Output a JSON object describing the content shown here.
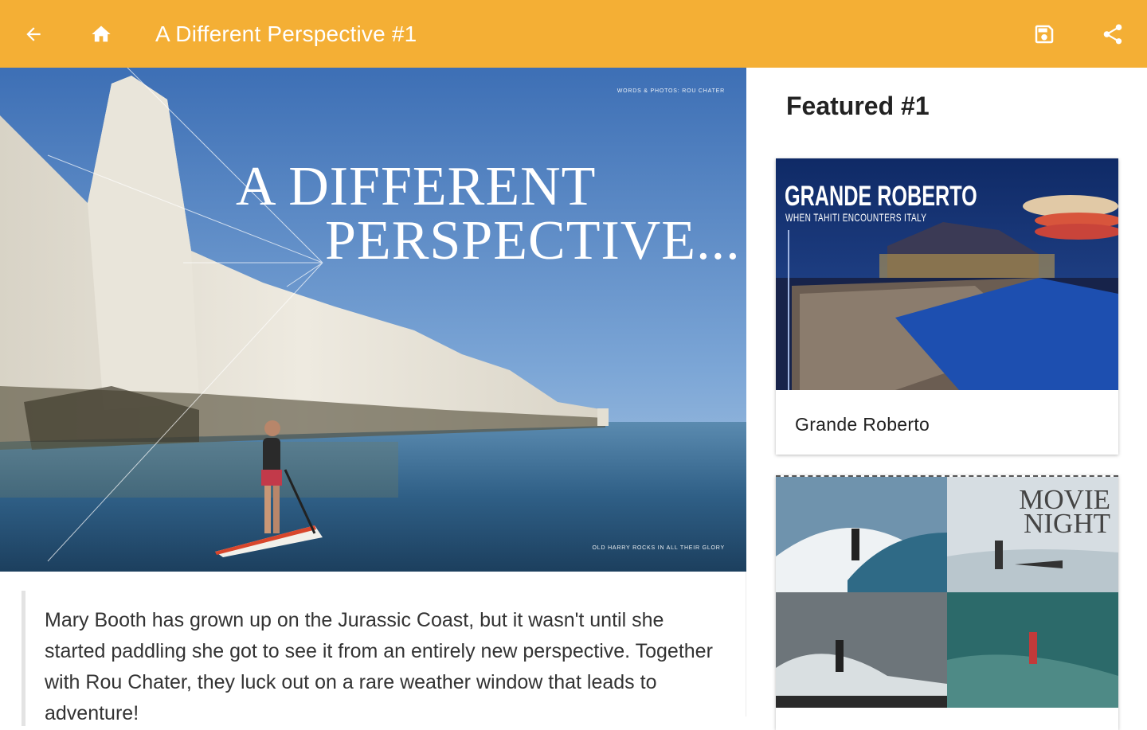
{
  "toolbar": {
    "title": "A Different Perspective #1",
    "back_icon": "arrow-left-icon",
    "home_icon": "home-icon",
    "save_icon": "save-icon",
    "share_icon": "share-icon",
    "background_color": "#F4AF35"
  },
  "hero": {
    "headline_line1": "A DIFFERENT",
    "headline_line2": "PERSPECTIVE...",
    "credit": "WORDS & PHOTOS: ROU CHATER",
    "caption": "OLD HARRY ROCKS IN ALL THEIR GLORY"
  },
  "article": {
    "intro": "Mary Booth has grown up on the Jurassic Coast, but it wasn't until she started paddling she got to see it from an entirely new perspective. Together with Rou Chater, they luck out on a rare weather window that leads to adventure!"
  },
  "sidebar": {
    "title": "Featured #1",
    "cards": [
      {
        "label": "Grande Roberto",
        "image_title": "GRANDE ROBERTO",
        "image_subtitle": "WHEN TAHITI ENCOUNTERS ITALY"
      },
      {
        "label": "",
        "image_title_line1": "MOVIE",
        "image_title_line2": "NIGHT"
      }
    ]
  }
}
